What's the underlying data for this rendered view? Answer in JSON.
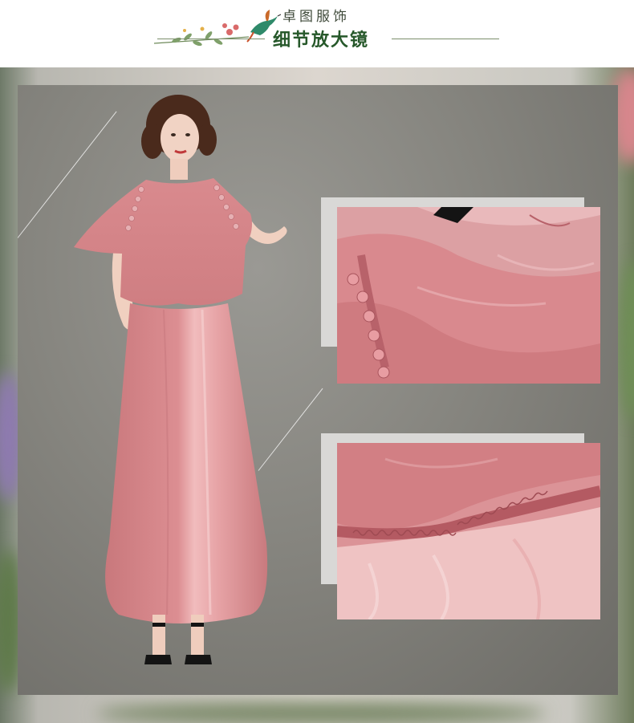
{
  "header": {
    "brand": "卓图服饰",
    "section_title": "细节放大镜"
  },
  "icons": {
    "flower": "flower-branch-icon",
    "bird": "hummingbird-icon"
  },
  "colors": {
    "title_green": "#26582a",
    "dress_pink": "#d9868a",
    "studio_gray": "#86857f"
  }
}
